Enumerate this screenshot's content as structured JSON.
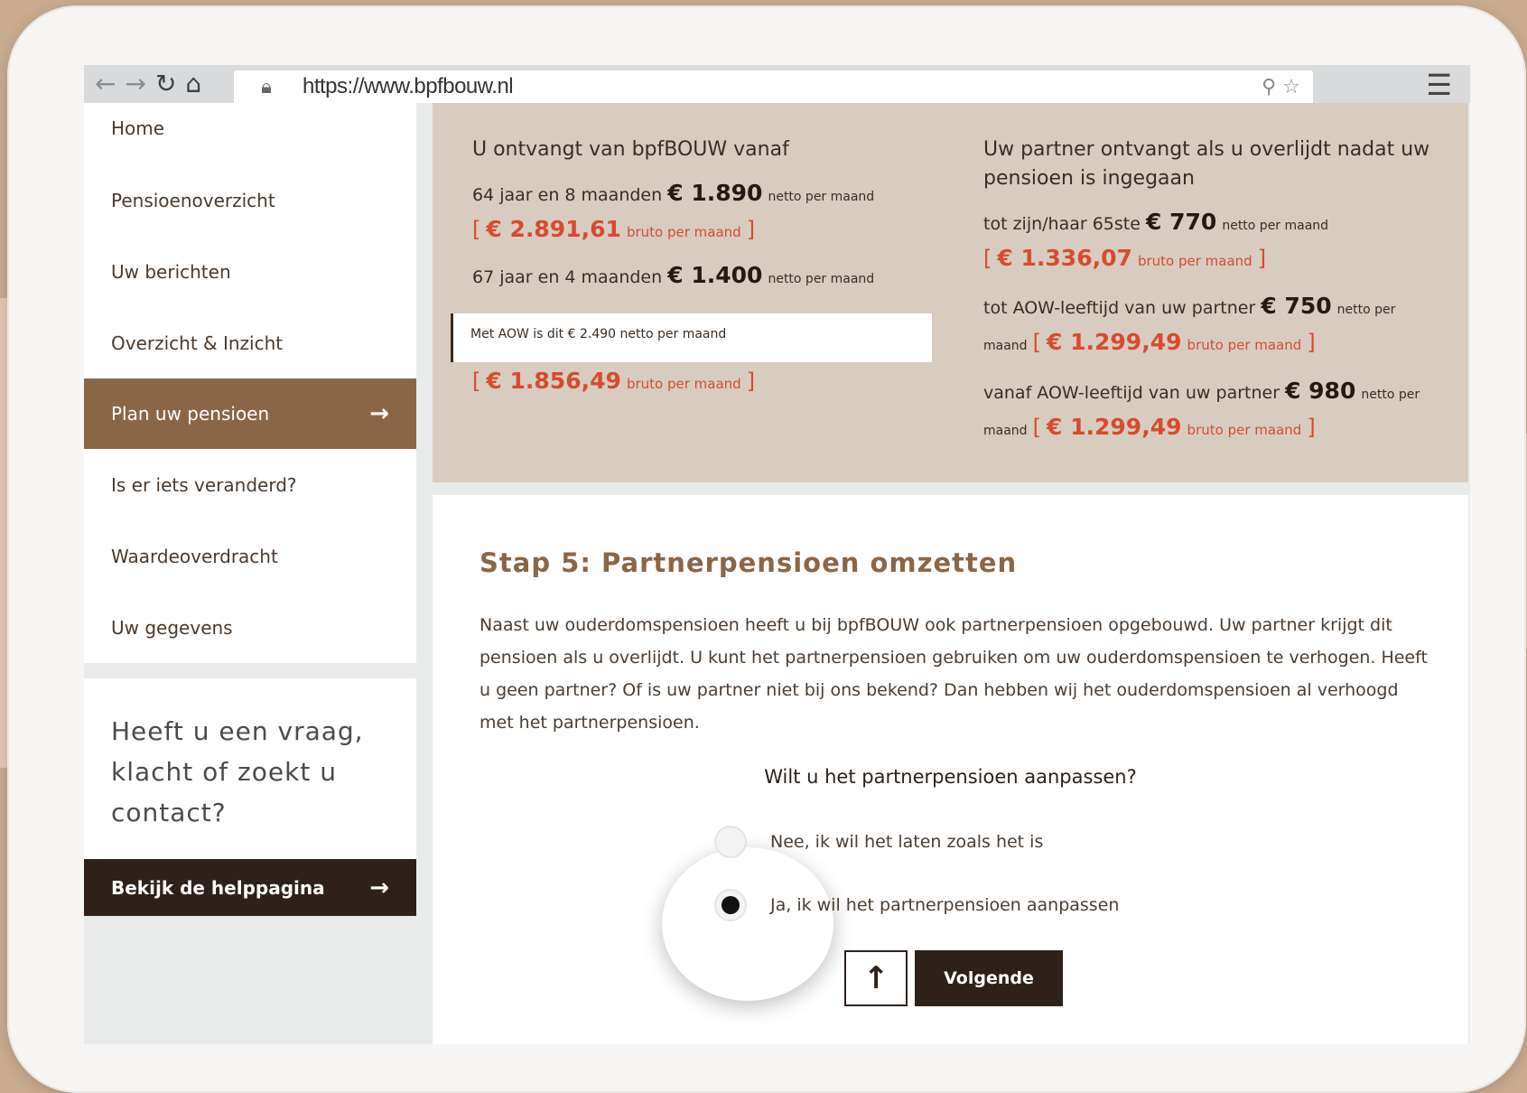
{
  "browser": {
    "url": "https://www.bpfbouw.nl"
  },
  "sidebar": {
    "items": [
      {
        "label": "Home"
      },
      {
        "label": "Pensioenoverzicht"
      },
      {
        "label": "Uw berichten"
      },
      {
        "label": "Overzicht & Inzicht"
      },
      {
        "label": "Plan uw pensioen",
        "active": true
      },
      {
        "label": "Is er iets veranderd?"
      },
      {
        "label": "Waardeoverdracht"
      },
      {
        "label": "Uw gegevens"
      }
    ],
    "help_question": "Heeft u een vraag, klacht of zoekt u contact?",
    "help_button": "Bekijk de helppagina"
  },
  "summary": {
    "left": {
      "heading": "U ontvangt van bpfBOUW vanaf",
      "row1_label": "64 jaar en 8 maanden",
      "row1_net": "€ 1.890",
      "row1_bruto": "€ 2.891,61",
      "row2_label": "67 jaar en 4 maanden",
      "row2_net": "€ 1.400",
      "aow_text": "Met AOW is dit  € 2.490 netto per maand",
      "row2_bruto": "€ 1.856,49"
    },
    "right": {
      "heading": "Uw partner ontvangt als u overlijdt nadat uw pensioen is ingegaan",
      "row1_label": "tot zijn/haar 65ste",
      "row1_net": "€ 770",
      "row1_bruto": "€ 1.336,07",
      "row2_label": "tot AOW-leeftijd van uw partner",
      "row2_net": "€ 750",
      "row2_bruto": "€ 1.299,49",
      "row3_label": "vanaf AOW-leeftijd van uw partner",
      "row3_net": "€ 980",
      "row3_bruto": "€ 1.299,49"
    },
    "netto_suffix": "netto per maand",
    "netto_per": "netto per",
    "maand": "maand",
    "bruto_suffix": "bruto per maand",
    "open_bracket": "[",
    "close_bracket": "]"
  },
  "step": {
    "title": "Stap 5: Partnerpensioen omzetten",
    "text": "Naast uw ouderdomspensioen heeft u bij bpfBOUW ook partnerpensioen opgebouwd. Uw partner krijgt dit pensioen als u overlijdt. U kunt het partnerpensioen gebruiken om uw ouderdomspensioen te verhogen. Heeft u geen partner? Of is uw partner niet bij ons bekend? Dan hebben wij het ouderdomspensioen al verhoogd met het partnerpensioen.",
    "question": "Wilt u het partnerpensioen aanpassen?",
    "option_no": "Nee, ik wil het laten zoals het is",
    "option_yes": "Ja, ik wil het partnerpensioen aanpassen",
    "selected": "yes",
    "back_icon": "↑",
    "next_button": "Volgende"
  },
  "icons": {
    "back": "arrow-left-icon",
    "forward": "arrow-right-icon",
    "reload": "reload-icon",
    "home": "home-icon",
    "lock": "lock-icon",
    "search": "search-icon",
    "star": "star-icon",
    "menu": "hamburger-menu-icon"
  },
  "colors": {
    "accent_brown": "#8a6647",
    "dark": "#2d2119",
    "summary_bg": "#d8ccc1",
    "bruto_red": "#d74b2e"
  }
}
